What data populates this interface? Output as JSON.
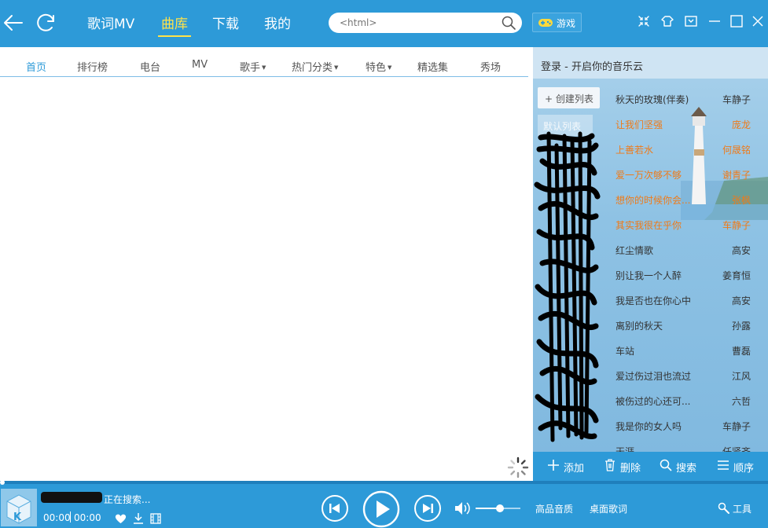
{
  "topbar": {
    "nav": [
      "歌词MV",
      "曲库",
      "下载",
      "我的"
    ],
    "active_nav": "曲库",
    "search_placeholder": "<html>",
    "game_label": "游戏"
  },
  "subnav": {
    "tabs": [
      "首页",
      "排行榜",
      "电台",
      "MV",
      "歌手",
      "热门分类",
      "特色",
      "精选集",
      "秀场"
    ],
    "active": "首页"
  },
  "right_panel": {
    "header": "登录 - 开启你的音乐云",
    "create_list": "+ 创建列表",
    "default_list": "默认列表",
    "songs": [
      {
        "title": "秋天的玫瑰(伴奏)",
        "artist": "车静子",
        "highlight": false
      },
      {
        "title": "让我们坚强",
        "artist": "庞龙",
        "highlight": true
      },
      {
        "title": "上善若水",
        "artist": "何晟铭",
        "highlight": true
      },
      {
        "title": "爱一万次够不够",
        "artist": "谢青子",
        "highlight": true
      },
      {
        "title": "想你的时候你会...",
        "artist": "张枫",
        "highlight": true
      },
      {
        "title": "其实我很在乎你",
        "artist": "车静子",
        "highlight": true
      },
      {
        "title": "红尘情歌",
        "artist": "高安",
        "highlight": false
      },
      {
        "title": "别让我一个人醉",
        "artist": "姜育恒",
        "highlight": false
      },
      {
        "title": "我是否也在你心中",
        "artist": "高安",
        "highlight": false
      },
      {
        "title": "离别的秋天",
        "artist": "孙露",
        "highlight": false
      },
      {
        "title": "车站",
        "artist": "曹磊",
        "highlight": false
      },
      {
        "title": "爱过伤过泪也流过",
        "artist": "江风",
        "highlight": false
      },
      {
        "title": "被伤过的心还可...",
        "artist": "六哲",
        "highlight": false
      },
      {
        "title": "我是你的女人吗",
        "artist": "车静子",
        "highlight": false
      },
      {
        "title": "天涯",
        "artist": "任贤齐",
        "highlight": false
      }
    ],
    "footer": {
      "add": "添加",
      "delete": "删除",
      "search": "搜索",
      "order": "顺序"
    }
  },
  "player": {
    "status": "正在搜索...",
    "time_current": "00:00",
    "time_total": "00:00",
    "progress": 0,
    "volume": 0.55,
    "hq_label": "高品音质",
    "lyrics_label": "桌面歌词",
    "tools_label": "工具"
  },
  "colors": {
    "primary": "#2d9ad8",
    "active_nav": "#ffe24a",
    "highlight_song": "#ef7a18",
    "active_subtab": "#2d9ad8"
  }
}
